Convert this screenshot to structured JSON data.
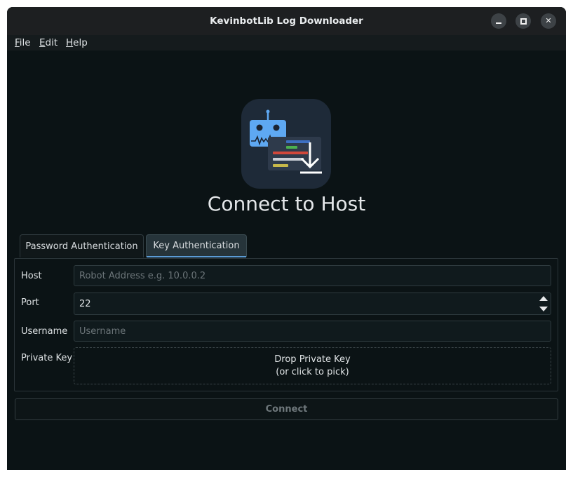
{
  "window": {
    "title": "KevinbotLib Log Downloader",
    "controls": [
      "minimize",
      "maximize",
      "close"
    ]
  },
  "menubar": {
    "file": {
      "mnemonic": "F",
      "rest": "ile"
    },
    "edit": {
      "mnemonic": "E",
      "rest": "dit"
    },
    "help": {
      "mnemonic": "H",
      "rest": "elp"
    }
  },
  "logo": {
    "icon": "robot-log-download-icon"
  },
  "heading": "Connect to Host",
  "tabs": [
    {
      "label": "Password Authentication",
      "selected": false
    },
    {
      "label": "Key Authentication",
      "selected": true
    }
  ],
  "form": {
    "host": {
      "label": "Host",
      "value": "",
      "placeholder": "Robot Address e.g. 10.0.0.2"
    },
    "port": {
      "label": "Port",
      "value": "22"
    },
    "username": {
      "label": "Username",
      "value": "",
      "placeholder": "Username"
    },
    "private_key": {
      "label": "Private Key",
      "drop_line1": "Drop Private Key",
      "drop_line2": "(or click to pick)"
    }
  },
  "connect_label": "Connect",
  "colors": {
    "background": "#0b1315",
    "accent": "#5b9bd5",
    "titlebar": "#1d1f21"
  }
}
